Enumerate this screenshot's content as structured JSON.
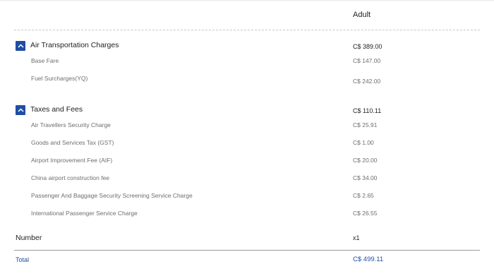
{
  "header": {
    "passenger_type": "Adult"
  },
  "sections": [
    {
      "title": "Air Transportation Charges",
      "value": "C$ 389.00",
      "items": [
        {
          "label": "Base Fare",
          "value": "C$ 147.00"
        },
        {
          "label": "Fuel Surcharges(YQ)",
          "value": "C$ 242.00"
        }
      ]
    },
    {
      "title": "Taxes and Fees",
      "value": "C$ 110.11",
      "items": [
        {
          "label": "Air Travellers Security Charge",
          "value": "C$ 25.91"
        },
        {
          "label": "Goods and Services Tax (GST)",
          "value": "C$ 1.00"
        },
        {
          "label": "Airport Improvement Fee (AIF)",
          "value": "C$ 20.00"
        },
        {
          "label": "China airport construction fee",
          "value": "C$ 34.00"
        },
        {
          "label": "Passenger And Baggage Security Screening Service Charge",
          "value": "C$ 2.65"
        },
        {
          "label": "International Passenger Service Charge",
          "value": "C$ 26.55"
        }
      ]
    }
  ],
  "number": {
    "label": "Number",
    "value": "x1"
  },
  "total": {
    "label": "Total",
    "value": "C$ 499.11"
  },
  "colors": {
    "accent": "#1f4ea3",
    "muted_text": "#6e6e6e"
  },
  "icons": {
    "section_toggle": "chevron-up-icon"
  }
}
